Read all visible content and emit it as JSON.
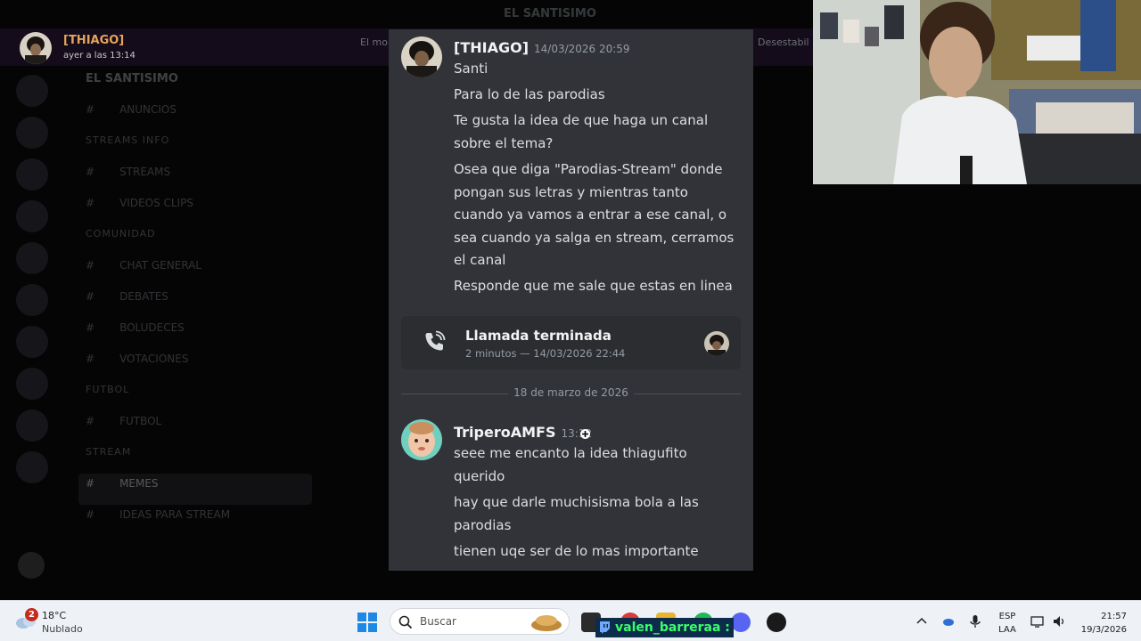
{
  "app": {
    "title": "EL SANTISIMO"
  },
  "notification": {
    "author": "[THIAGO]",
    "time": "ayer a las 13:14",
    "hint": "El mo",
    "hint_right": "Desestabil"
  },
  "background": {
    "server_name": "EL SANTISIMO",
    "channels": [
      {
        "label": "ANUNCIOS",
        "kind": "channel"
      },
      {
        "label": "STREAMS INFO",
        "kind": "category"
      },
      {
        "label": "STREAMS",
        "kind": "channel"
      },
      {
        "label": "VIDEOS CLIPS",
        "kind": "channel"
      },
      {
        "label": "COMUNIDAD",
        "kind": "category"
      },
      {
        "label": "CHAT GENERAL",
        "kind": "channel"
      },
      {
        "label": "DEBATES",
        "kind": "channel"
      },
      {
        "label": "BOLUDECES",
        "kind": "channel"
      },
      {
        "label": "VOTACIONES",
        "kind": "channel"
      },
      {
        "label": "FUTBOL",
        "kind": "category"
      },
      {
        "label": "FUTBOL",
        "kind": "channel"
      },
      {
        "label": "STREAM",
        "kind": "category"
      },
      {
        "label": "MEMES",
        "kind": "channel",
        "active": true
      },
      {
        "label": "IDEAS PARA STREAM",
        "kind": "channel"
      }
    ]
  },
  "panel": {
    "first_message": {
      "author": "[THIAGO]",
      "timestamp": "14/03/2026 20:59",
      "lines": [
        "Santi",
        "Para lo de las parodias",
        "Te gusta la idea de que haga un canal",
        "sobre el tema?",
        "Osea que diga \"Parodias-Stream\" donde",
        "pongan sus letras y mientras tanto",
        "cuando ya vamos a entrar a ese canal, o",
        "sea cuando ya salga en stream, cerramos",
        "el canal",
        "Responde que me sale que estas en linea"
      ]
    },
    "call": {
      "title": "Llamada terminada",
      "subtitle": "2 minutos — 14/03/2026 22:44"
    },
    "date_divider": "18 de marzo de 2026",
    "second_message": {
      "author": "TriperoAMFS",
      "timestamp": "13:12",
      "lines": [
        "seee me encanto la idea thiagufito",
        "querido",
        "hay que darle muchisisma bola  a las",
        "parodias",
        "tienen uqe ser de lo mas importante"
      ]
    }
  },
  "taskbar": {
    "weather": {
      "temp": "18°C",
      "condition": "Nublado",
      "badge": "2"
    },
    "search_placeholder": "Buscar",
    "overlay_username": "valen_barreraa :",
    "language": [
      "ESP",
      "LAA"
    ],
    "clock": {
      "time": "21:57",
      "date": "19/3/2026"
    }
  },
  "colors": {
    "panel_bg": "#313338",
    "author_accent": "#e7a35c",
    "overlay_text": "#39ff6a",
    "badge": "#c42b1c"
  }
}
